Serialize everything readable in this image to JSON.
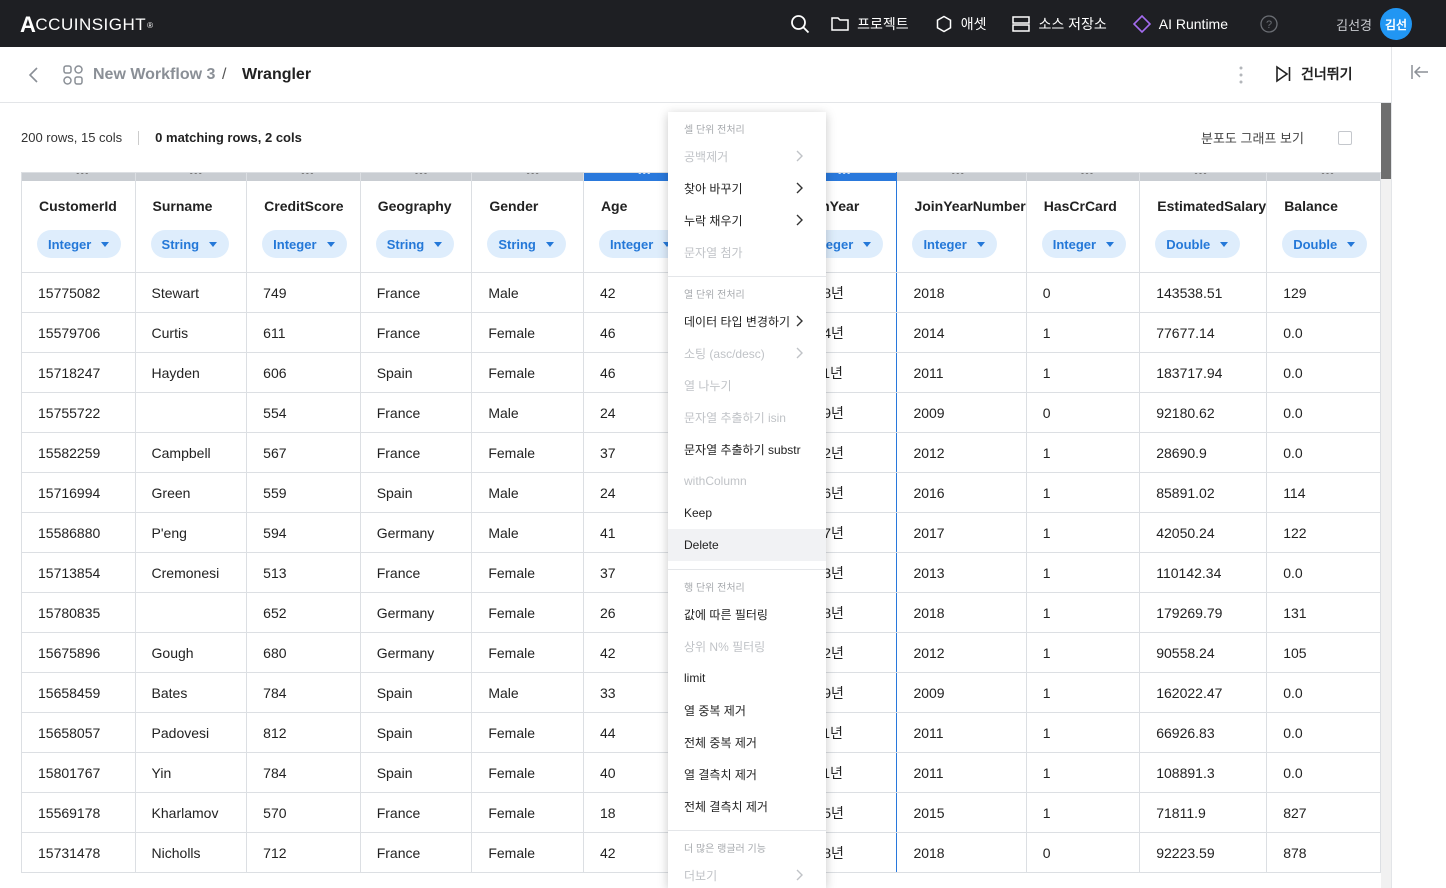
{
  "topbar": {
    "logo_text": "CCUINSIGHT",
    "logo_mark": "A",
    "logo_reg": "®",
    "nav": [
      {
        "label": "프로젝트",
        "icon": "folder-icon"
      },
      {
        "label": "애셋",
        "icon": "hexagon-icon"
      },
      {
        "label": "소스 저장소",
        "icon": "storage-icon"
      },
      {
        "label": "AI Runtime",
        "icon": "diamond-icon",
        "accent": "#a46cf0"
      }
    ],
    "user_name": "김선경",
    "avatar_text": "김선"
  },
  "subbar": {
    "workflow": "New Workflow 3",
    "separator": "/",
    "page": "Wrangler",
    "skip_label": "건너뛰기"
  },
  "stats": {
    "rows_cols": "200 rows, 15 cols",
    "matching": "0 matching rows, 2 cols",
    "dist_label": "분포도 그래프 보기"
  },
  "colors": {
    "accent": "#2878dc",
    "chip_bg": "#deedfc",
    "topbar_bg": "#1e1f23"
  },
  "table": {
    "columns": [
      {
        "name": "CustomerId",
        "type": "Integer"
      },
      {
        "name": "Surname",
        "type": "String"
      },
      {
        "name": "CreditScore",
        "type": "Integer"
      },
      {
        "name": "Geography",
        "type": "String"
      },
      {
        "name": "Gender",
        "type": "String"
      },
      {
        "name": "Age",
        "type": "Integer",
        "selected": true
      },
      {
        "name": "",
        "type": ""
      },
      {
        "name": "JoinYear",
        "type": "Integer",
        "selected": true
      },
      {
        "name": "JoinYearNumber",
        "type": "Integer"
      },
      {
        "name": "HasCrCard",
        "type": "Integer"
      },
      {
        "name": "EstimatedSalary",
        "type": "Double"
      },
      {
        "name": "Balance",
        "type": "Double"
      }
    ],
    "rows": [
      [
        "15775082",
        "Stewart",
        "749",
        "France",
        "Male",
        "42",
        "",
        "2018년",
        "2018",
        "0",
        "143538.51",
        "129"
      ],
      [
        "15579706",
        "Curtis",
        "611",
        "France",
        "Female",
        "46",
        "",
        "2014년",
        "2014",
        "1",
        "77677.14",
        "0.0"
      ],
      [
        "15718247",
        "Hayden",
        "606",
        "Spain",
        "Female",
        "46",
        "",
        "2011년",
        "2011",
        "1",
        "183717.94",
        "0.0"
      ],
      [
        "15755722",
        "",
        "554",
        "France",
        "Male",
        "24",
        "",
        "2009년",
        "2009",
        "0",
        "92180.62",
        "0.0"
      ],
      [
        "15582259",
        "Campbell",
        "567",
        "France",
        "Female",
        "37",
        "",
        "2012년",
        "2012",
        "1",
        "28690.9",
        "0.0"
      ],
      [
        "15716994",
        "Green",
        "559",
        "Spain",
        "Male",
        "24",
        "",
        "2016년",
        "2016",
        "1",
        "85891.02",
        "114"
      ],
      [
        "15586880",
        "P'eng",
        "594",
        "Germany",
        "Male",
        "41",
        "",
        "2017년",
        "2017",
        "1",
        "42050.24",
        "122"
      ],
      [
        "15713854",
        "Cremonesi",
        "513",
        "France",
        "Female",
        "37",
        "",
        "2013년",
        "2013",
        "1",
        "110142.34",
        "0.0"
      ],
      [
        "15780835",
        "",
        "652",
        "Germany",
        "Female",
        "26",
        "",
        "2018년",
        "2018",
        "1",
        "179269.79",
        "131"
      ],
      [
        "15675896",
        "Gough",
        "680",
        "Germany",
        "Female",
        "42",
        "",
        "2012년",
        "2012",
        "1",
        "90558.24",
        "105"
      ],
      [
        "15658459",
        "Bates",
        "784",
        "Spain",
        "Male",
        "33",
        "",
        "2009년",
        "2009",
        "1",
        "162022.47",
        "0.0"
      ],
      [
        "15658057",
        "Padovesi",
        "812",
        "Spain",
        "Female",
        "44",
        "",
        "2011년",
        "2011",
        "1",
        "66926.83",
        "0.0"
      ],
      [
        "15801767",
        "Yin",
        "784",
        "Spain",
        "Female",
        "40",
        "",
        "2011년",
        "2011",
        "1",
        "108891.3",
        "0.0"
      ],
      [
        "15569178",
        "Kharlamov",
        "570",
        "France",
        "Female",
        "18",
        "",
        "2015년",
        "2015",
        "1",
        "71811.9",
        "827"
      ],
      [
        "15731478",
        "Nicholls",
        "712",
        "France",
        "Female",
        "42",
        "",
        "2018년",
        "2018",
        "0",
        "92223.59",
        "878"
      ]
    ]
  },
  "context_menu": {
    "groups": [
      {
        "header": "셀 단위 전처리",
        "items": [
          {
            "label": "공백제거",
            "disabled": true,
            "submenu": true
          },
          {
            "label": "찾아 바꾸기",
            "disabled": false,
            "submenu": true
          },
          {
            "label": "누락 채우기",
            "disabled": false,
            "submenu": true
          },
          {
            "label": "문자열 첨가",
            "disabled": true,
            "submenu": false
          }
        ]
      },
      {
        "header": "열 단위 전처리",
        "items": [
          {
            "label": "데이터 타입 변경하기",
            "disabled": false,
            "submenu": true
          },
          {
            "label": "소팅 (asc/desc)",
            "disabled": true,
            "submenu": true
          },
          {
            "label": "열 나누기",
            "disabled": true,
            "submenu": false
          },
          {
            "label": "문자열 추출하기 isin",
            "disabled": true,
            "submenu": false
          },
          {
            "label": "문자열 추출하기 substr",
            "disabled": false,
            "submenu": false
          },
          {
            "label": "withColumn",
            "disabled": true,
            "submenu": false
          },
          {
            "label": "Keep",
            "disabled": false,
            "submenu": false
          },
          {
            "label": "Delete",
            "disabled": false,
            "submenu": false,
            "hover": true
          }
        ]
      },
      {
        "header": "행 단위 전처리",
        "items": [
          {
            "label": "값에 따른 필터링",
            "disabled": false,
            "submenu": false
          },
          {
            "label": "상위 N% 필터링",
            "disabled": true,
            "submenu": false
          },
          {
            "label": "limit",
            "disabled": false,
            "submenu": false
          },
          {
            "label": "열 중복 제거",
            "disabled": false,
            "submenu": false
          },
          {
            "label": "전체 중복 제거",
            "disabled": false,
            "submenu": false
          },
          {
            "label": "열 결측치 제거",
            "disabled": false,
            "submenu": false
          },
          {
            "label": "전체 결측치 제거",
            "disabled": false,
            "submenu": false
          }
        ]
      },
      {
        "header": "더 많은 랭글러 기능",
        "items": [
          {
            "label": "더보기",
            "disabled": true,
            "submenu": true
          }
        ]
      }
    ]
  }
}
